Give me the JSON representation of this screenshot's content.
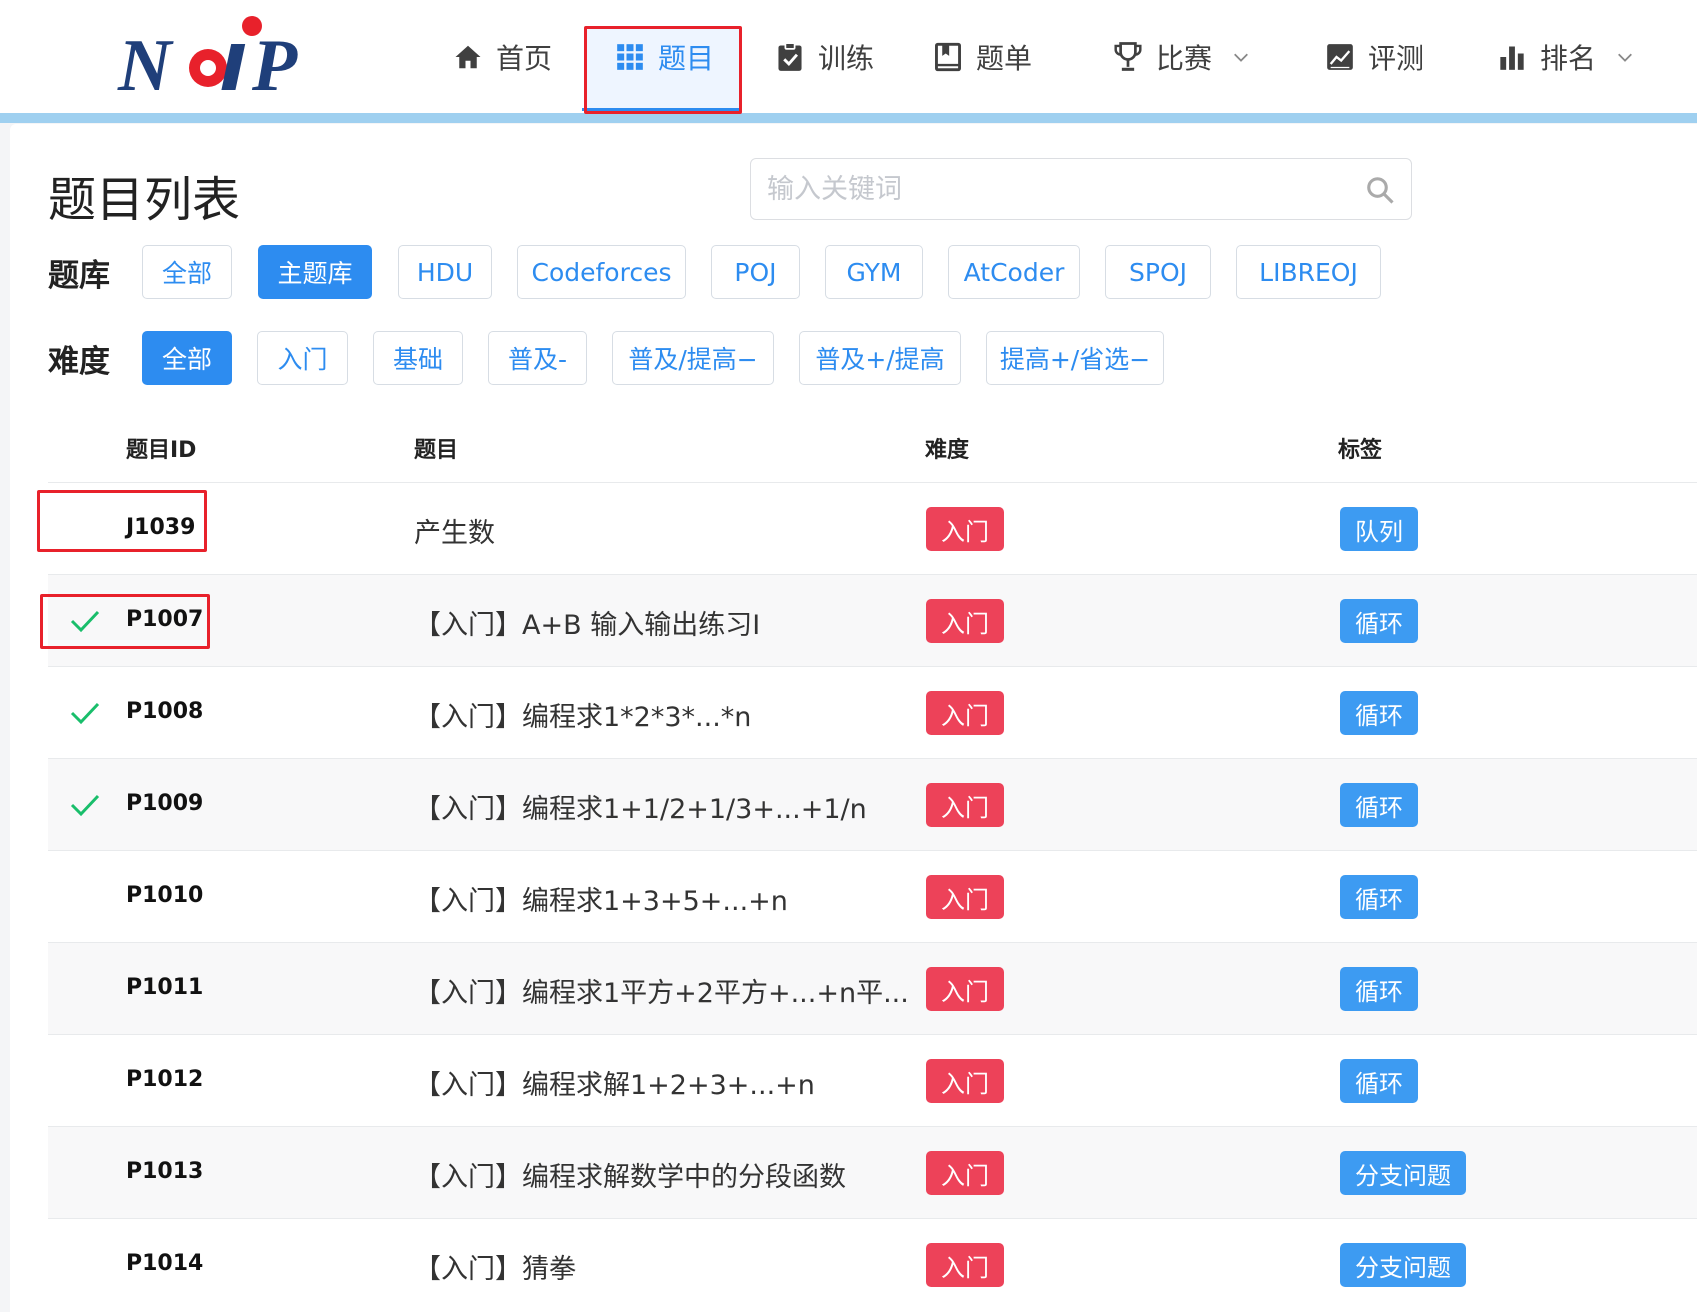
{
  "logo": {
    "text": "NOIP"
  },
  "nav": [
    {
      "label": "首页",
      "icon": "home-icon"
    },
    {
      "label": "题目",
      "icon": "grid-icon",
      "active": true
    },
    {
      "label": "训练",
      "icon": "clipboard-check-icon"
    },
    {
      "label": "题单",
      "icon": "book-list-icon"
    },
    {
      "label": "比赛",
      "icon": "trophy-icon",
      "dropdown": true
    },
    {
      "label": "评测",
      "icon": "chart-line-icon"
    },
    {
      "label": "排名",
      "icon": "bar-chart-icon",
      "dropdown": true
    }
  ],
  "page": {
    "title": "题目列表"
  },
  "search": {
    "placeholder": "输入关键词"
  },
  "bank": {
    "label": "题库",
    "options": [
      "全部",
      "主题库",
      "HDU",
      "Codeforces",
      "POJ",
      "GYM",
      "AtCoder",
      "SPOJ",
      "LIBREOJ"
    ],
    "selected": "主题库"
  },
  "difficulty": {
    "label": "难度",
    "options": [
      "全部",
      "入门",
      "基础",
      "普及-",
      "普及/提高−",
      "普及+/提高",
      "提高+/省选−"
    ],
    "selected": "全部"
  },
  "table": {
    "headers": [
      "题目ID",
      "题目",
      "难度",
      "标签"
    ],
    "rows": [
      {
        "solved": false,
        "id": "J1039",
        "title": "产生数",
        "difficulty": "入门",
        "tag": "队列"
      },
      {
        "solved": true,
        "id": "P1007",
        "title": "【入门】A+B 输入输出练习I",
        "difficulty": "入门",
        "tag": "循环"
      },
      {
        "solved": true,
        "id": "P1008",
        "title": "【入门】编程求1*2*3*...*n",
        "difficulty": "入门",
        "tag": "循环"
      },
      {
        "solved": true,
        "id": "P1009",
        "title": "【入门】编程求1+1/2+1/3+...+1/n",
        "difficulty": "入门",
        "tag": "循环"
      },
      {
        "solved": false,
        "id": "P1010",
        "title": "【入门】编程求1+3+5+...+n",
        "difficulty": "入门",
        "tag": "循环"
      },
      {
        "solved": false,
        "id": "P1011",
        "title": "【入门】编程求1平方+2平方+...+n平...",
        "difficulty": "入门",
        "tag": "循环"
      },
      {
        "solved": false,
        "id": "P1012",
        "title": "【入门】编程求解1+2+3+...+n",
        "difficulty": "入门",
        "tag": "循环"
      },
      {
        "solved": false,
        "id": "P1013",
        "title": "【入门】编程求解数学中的分段函数",
        "difficulty": "入门",
        "tag": "分支问题"
      },
      {
        "solved": false,
        "id": "P1014",
        "title": "【入门】猜拳",
        "difficulty": "入门",
        "tag": "分支问题"
      }
    ]
  },
  "colors": {
    "accent": "#2d8cf0",
    "difficulty_entry": "#ed4259",
    "tag": "#3d9bf2",
    "solved_check": "#19be6b",
    "highlight_box": "#e8212b"
  }
}
